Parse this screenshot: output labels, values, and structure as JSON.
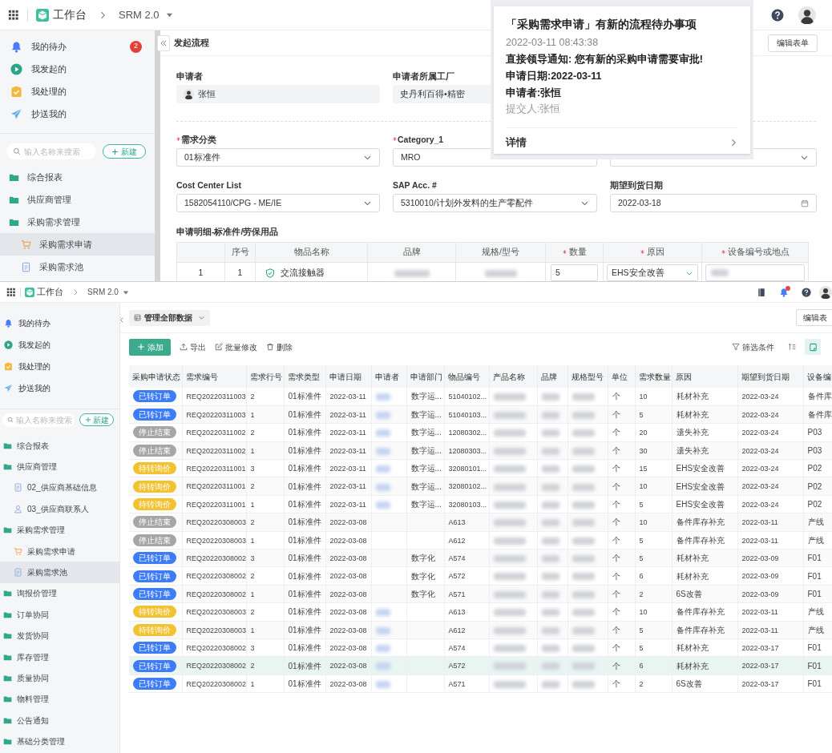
{
  "top": {
    "header": {
      "app": "工作台",
      "product": "SRM 2.0"
    },
    "sidebar": {
      "nav": [
        {
          "kind": "bell",
          "label": "我的待办",
          "badge": "2"
        },
        {
          "kind": "play",
          "label": "我发起的"
        },
        {
          "kind": "task",
          "label": "我处理的"
        },
        {
          "kind": "send",
          "label": "抄送我的"
        }
      ],
      "search": {
        "placeholder": "输入名称来搜索"
      },
      "new_button": "新建",
      "tree": [
        {
          "kind": "folder",
          "label": "综合报表",
          "selected": false
        },
        {
          "kind": "folder",
          "label": "供应商管理",
          "selected": false
        },
        {
          "kind": "folder",
          "label": "采购需求管理",
          "selected": false,
          "children": [
            {
              "kind": "cart",
              "label": "采购需求申请",
              "selected": true
            },
            {
              "kind": "doc",
              "label": "采购需求池",
              "selected": false
            }
          ]
        }
      ]
    },
    "page_title": "发起流程",
    "edit_button": "编辑表单",
    "form_rows": [
      [
        {
          "kind": "person",
          "label": "申请者",
          "value": "张恒"
        },
        {
          "kind": "readonly",
          "label": "申请者所属工厂",
          "value": "史丹利百得•精密"
        }
      ],
      [
        {
          "kind": "select",
          "label": "需求分类",
          "required": true,
          "value": "01标准件"
        },
        {
          "kind": "text",
          "label": "Category_1",
          "required": true,
          "value": "MRO"
        },
        {
          "kind": "select"
        }
      ],
      [
        {
          "kind": "select",
          "label": "Cost Center List",
          "value": "1582054110/CPG - ME/IE"
        },
        {
          "kind": "select",
          "label": "SAP Acc. #",
          "value": "5310010/计划外发料的生产零配件"
        },
        {
          "kind": "date",
          "label": "期望到货日期",
          "value": "2022-03-18"
        }
      ]
    ],
    "detail": {
      "title": "申请明细-标准件/劳保用品",
      "columns": [
        {
          "label": "序号"
        },
        {
          "label": "物品名称"
        },
        {
          "label": "品牌"
        },
        {
          "label": "规格/型号"
        },
        {
          "label": "数量",
          "required": true
        },
        {
          "label": "原因",
          "required": true
        },
        {
          "label": "设备编号或地点",
          "required": true
        }
      ],
      "rows": [
        {
          "index": "1",
          "seq": "1",
          "item": "交流接触器",
          "quantity": "5",
          "reason": "EHS安全改善"
        }
      ]
    },
    "notification": {
      "title": "「采购需求申请」有新的流程待办事项",
      "time": "2022-03-11 08:43:38",
      "lines": [
        {
          "text": "直接领导通知: 您有新的采购申请需要审批!",
          "muted": false
        },
        {
          "text": "申请日期:2022-03-11",
          "muted": false
        },
        {
          "text": "申请者:张恒",
          "muted": false
        },
        {
          "text": "提交人:张恒",
          "muted": true
        }
      ],
      "link": "详情"
    }
  },
  "bottom": {
    "header": {
      "app": "工作台",
      "product": "SRM 2.0",
      "alert": true
    },
    "sidebar": {
      "nav": [
        {
          "kind": "bell",
          "label": "我的待办"
        },
        {
          "kind": "play",
          "label": "我发起的"
        },
        {
          "kind": "task",
          "label": "我处理的"
        },
        {
          "kind": "send",
          "label": "抄送我的"
        }
      ],
      "search": {
        "placeholder": "输入名称来搜索"
      },
      "new_button": "新建",
      "tree": [
        {
          "kind": "folder",
          "label": "综合报表",
          "selected": false
        },
        {
          "kind": "folder",
          "label": "供应商管理",
          "selected": false,
          "children": [
            {
              "kind": "doc",
              "label": "02_供应商基础信息",
              "selected": false
            },
            {
              "kind": "person",
              "label": "03_供应商联系人",
              "selected": false
            }
          ]
        },
        {
          "kind": "folder",
          "label": "采购需求管理",
          "selected": false,
          "children": [
            {
              "kind": "cart",
              "label": "采购需求申请",
              "selected": false
            },
            {
              "kind": "doc",
              "label": "采购需求池",
              "selected": true
            }
          ]
        },
        {
          "kind": "folder",
          "label": "询报价管理",
          "selected": false
        },
        {
          "kind": "folder",
          "label": "订单协同",
          "selected": false
        },
        {
          "kind": "folder",
          "label": "发货协同",
          "selected": false
        },
        {
          "kind": "folder",
          "label": "库存管理",
          "selected": false
        },
        {
          "kind": "folder",
          "label": "质量协同",
          "selected": false
        },
        {
          "kind": "folder",
          "label": "物料管理",
          "selected": false
        },
        {
          "kind": "folder",
          "label": "公告通知",
          "selected": false
        },
        {
          "kind": "folder",
          "label": "基础分类管理",
          "selected": false
        }
      ]
    },
    "view_selector": "管理全部数据",
    "edit_button": "编辑表",
    "toolbar": [
      {
        "kind": "add",
        "label": "添加"
      },
      {
        "kind": "export",
        "label": "导出"
      },
      {
        "kind": "edit",
        "label": "批量修改"
      },
      {
        "kind": "delete",
        "label": "删除"
      }
    ],
    "filter_button": "筛选条件",
    "table": {
      "columns": [
        "采购申请状态",
        "需求编号",
        "需求行号",
        "需求类型",
        "申请日期",
        "申请者",
        "申请部门",
        "物品编号",
        "产品名称",
        "品牌",
        "规格型号",
        "单位",
        "需求数量",
        "原因",
        "期望到货日期",
        "设备编"
      ],
      "rows": [
        {
          "status": "已转订单",
          "color": "#3d7cf5",
          "selected": false,
          "req_no": "REQ20220311003",
          "line": "2",
          "type": "01标准件",
          "date": "2022-03-11",
          "applicant_redacted": true,
          "dept": "数字运...",
          "item_no": "51040102...",
          "unit": "个",
          "qty": "10",
          "reason": "耗材补充",
          "due": "2022-03-24",
          "equipment": "备件库"
        },
        {
          "status": "已转订单",
          "color": "#3d7cf5",
          "selected": false,
          "req_no": "REQ20220311003",
          "line": "1",
          "type": "01标准件",
          "date": "2022-03-11",
          "applicant_redacted": true,
          "dept": "数字运...",
          "item_no": "51040103...",
          "unit": "个",
          "qty": "5",
          "reason": "耗材补充",
          "due": "2022-03-24",
          "equipment": "备件库"
        },
        {
          "status": "停止结束",
          "color": "#a6a6a6",
          "selected": false,
          "req_no": "REQ20220311002",
          "line": "2",
          "type": "01标准件",
          "date": "2022-03-11",
          "applicant_redacted": true,
          "dept": "数字运...",
          "item_no": "12080302...",
          "unit": "个",
          "qty": "20",
          "reason": "遗失补充",
          "due": "2022-03-24",
          "equipment": "P03"
        },
        {
          "status": "停止结束",
          "color": "#a6a6a6",
          "selected": false,
          "req_no": "REQ20220311002",
          "line": "1",
          "type": "01标准件",
          "date": "2022-03-11",
          "applicant_redacted": true,
          "dept": "数字运...",
          "item_no": "12080303...",
          "unit": "个",
          "qty": "30",
          "reason": "遗失补充",
          "due": "2022-03-24",
          "equipment": "P03"
        },
        {
          "status": "待转询价",
          "color": "#f2c230",
          "selected": false,
          "req_no": "REQ20220311001",
          "line": "3",
          "type": "01标准件",
          "date": "2022-03-11",
          "applicant_redacted": true,
          "dept": "数字运...",
          "item_no": "32080101...",
          "unit": "个",
          "qty": "15",
          "reason": "EHS安全改善",
          "due": "2022-03-24",
          "equipment": "P02"
        },
        {
          "status": "待转询价",
          "color": "#f2c230",
          "selected": false,
          "req_no": "REQ20220311001",
          "line": "2",
          "type": "01标准件",
          "date": "2022-03-11",
          "applicant_redacted": true,
          "dept": "数字运...",
          "item_no": "32080102...",
          "unit": "个",
          "qty": "10",
          "reason": "EHS安全改善",
          "due": "2022-03-24",
          "equipment": "P02"
        },
        {
          "status": "待转询价",
          "color": "#f2c230",
          "selected": false,
          "req_no": "REQ20220311001",
          "line": "1",
          "type": "01标准件",
          "date": "2022-03-11",
          "applicant_redacted": true,
          "dept": "数字运...",
          "item_no": "32080103...",
          "unit": "个",
          "qty": "5",
          "reason": "EHS安全改善",
          "due": "2022-03-24",
          "equipment": "P02"
        },
        {
          "status": "停止结束",
          "color": "#a6a6a6",
          "selected": false,
          "req_no": "REQ20220308003",
          "line": "2",
          "type": "01标准件",
          "date": "2022-03-08",
          "applicant_redacted": false,
          "item_no": "A613",
          "unit": "个",
          "qty": "10",
          "reason": "备件库存补充",
          "due": "2022-03-11",
          "equipment": "产线"
        },
        {
          "status": "停止结束",
          "color": "#a6a6a6",
          "selected": false,
          "req_no": "REQ20220308003",
          "line": "1",
          "type": "01标准件",
          "date": "2022-03-08",
          "applicant_redacted": false,
          "item_no": "A612",
          "unit": "个",
          "qty": "5",
          "reason": "备件库存补充",
          "due": "2022-03-11",
          "equipment": "产线"
        },
        {
          "status": "已转订单",
          "color": "#3d7cf5",
          "selected": false,
          "req_no": "REQ20220308002",
          "line": "3",
          "type": "01标准件",
          "date": "2022-03-08",
          "applicant_redacted": false,
          "dept": "数字化",
          "item_no": "A574",
          "unit": "个",
          "qty": "5",
          "reason": "耗材补充",
          "due": "2022-03-09",
          "equipment": "F01"
        },
        {
          "status": "已转订单",
          "color": "#3d7cf5",
          "selected": false,
          "req_no": "REQ20220308002",
          "line": "2",
          "type": "01标准件",
          "date": "2022-03-08",
          "applicant_redacted": false,
          "dept": "数字化",
          "item_no": "A572",
          "unit": "个",
          "qty": "6",
          "reason": "耗材补充",
          "due": "2022-03-09",
          "equipment": "F01"
        },
        {
          "status": "已转订单",
          "color": "#3d7cf5",
          "selected": false,
          "req_no": "REQ20220308002",
          "line": "1",
          "type": "01标准件",
          "date": "2022-03-08",
          "applicant_redacted": false,
          "dept": "数字化",
          "item_no": "A571",
          "unit": "个",
          "qty": "2",
          "reason": "6S改善",
          "due": "2022-03-09",
          "equipment": "F01"
        },
        {
          "status": "待转询价",
          "color": "#f2c230",
          "selected": false,
          "req_no": "REQ20220308003",
          "line": "2",
          "type": "01标准件",
          "date": "2022-03-08",
          "applicant_redacted": true,
          "item_no": "A613",
          "unit": "个",
          "qty": "10",
          "reason": "备件库存补充",
          "due": "2022-03-11",
          "equipment": "产线"
        },
        {
          "status": "待转询价",
          "color": "#f2c230",
          "selected": false,
          "req_no": "REQ20220308003",
          "line": "1",
          "type": "01标准件",
          "date": "2022-03-08",
          "applicant_redacted": true,
          "item_no": "A612",
          "unit": "个",
          "qty": "5",
          "reason": "备件库存补充",
          "due": "2022-03-11",
          "equipment": "产线"
        },
        {
          "status": "已转订单",
          "color": "#3d7cf5",
          "selected": false,
          "req_no": "REQ20220308002",
          "line": "3",
          "type": "01标准件",
          "date": "2022-03-08",
          "applicant_redacted": true,
          "item_no": "A574",
          "unit": "个",
          "qty": "5",
          "reason": "耗材补充",
          "due": "2022-03-17",
          "equipment": "F01"
        },
        {
          "status": "已转订单",
          "color": "#3d7cf5",
          "selected": true,
          "req_no": "REQ20220308002",
          "line": "2",
          "type": "01标准件",
          "date": "2022-03-08",
          "applicant_redacted": true,
          "item_no": "A572",
          "unit": "个",
          "qty": "6",
          "reason": "耗材补充",
          "due": "2022-03-17",
          "equipment": "F01"
        },
        {
          "status": "已转订单",
          "color": "#3d7cf5",
          "selected": false,
          "req_no": "REQ20220308002",
          "line": "1",
          "type": "01标准件",
          "date": "2022-03-08",
          "applicant_redacted": true,
          "item_no": "A571",
          "unit": "个",
          "qty": "2",
          "reason": "6S改善",
          "due": "2022-03-17",
          "equipment": "F01"
        }
      ]
    }
  }
}
